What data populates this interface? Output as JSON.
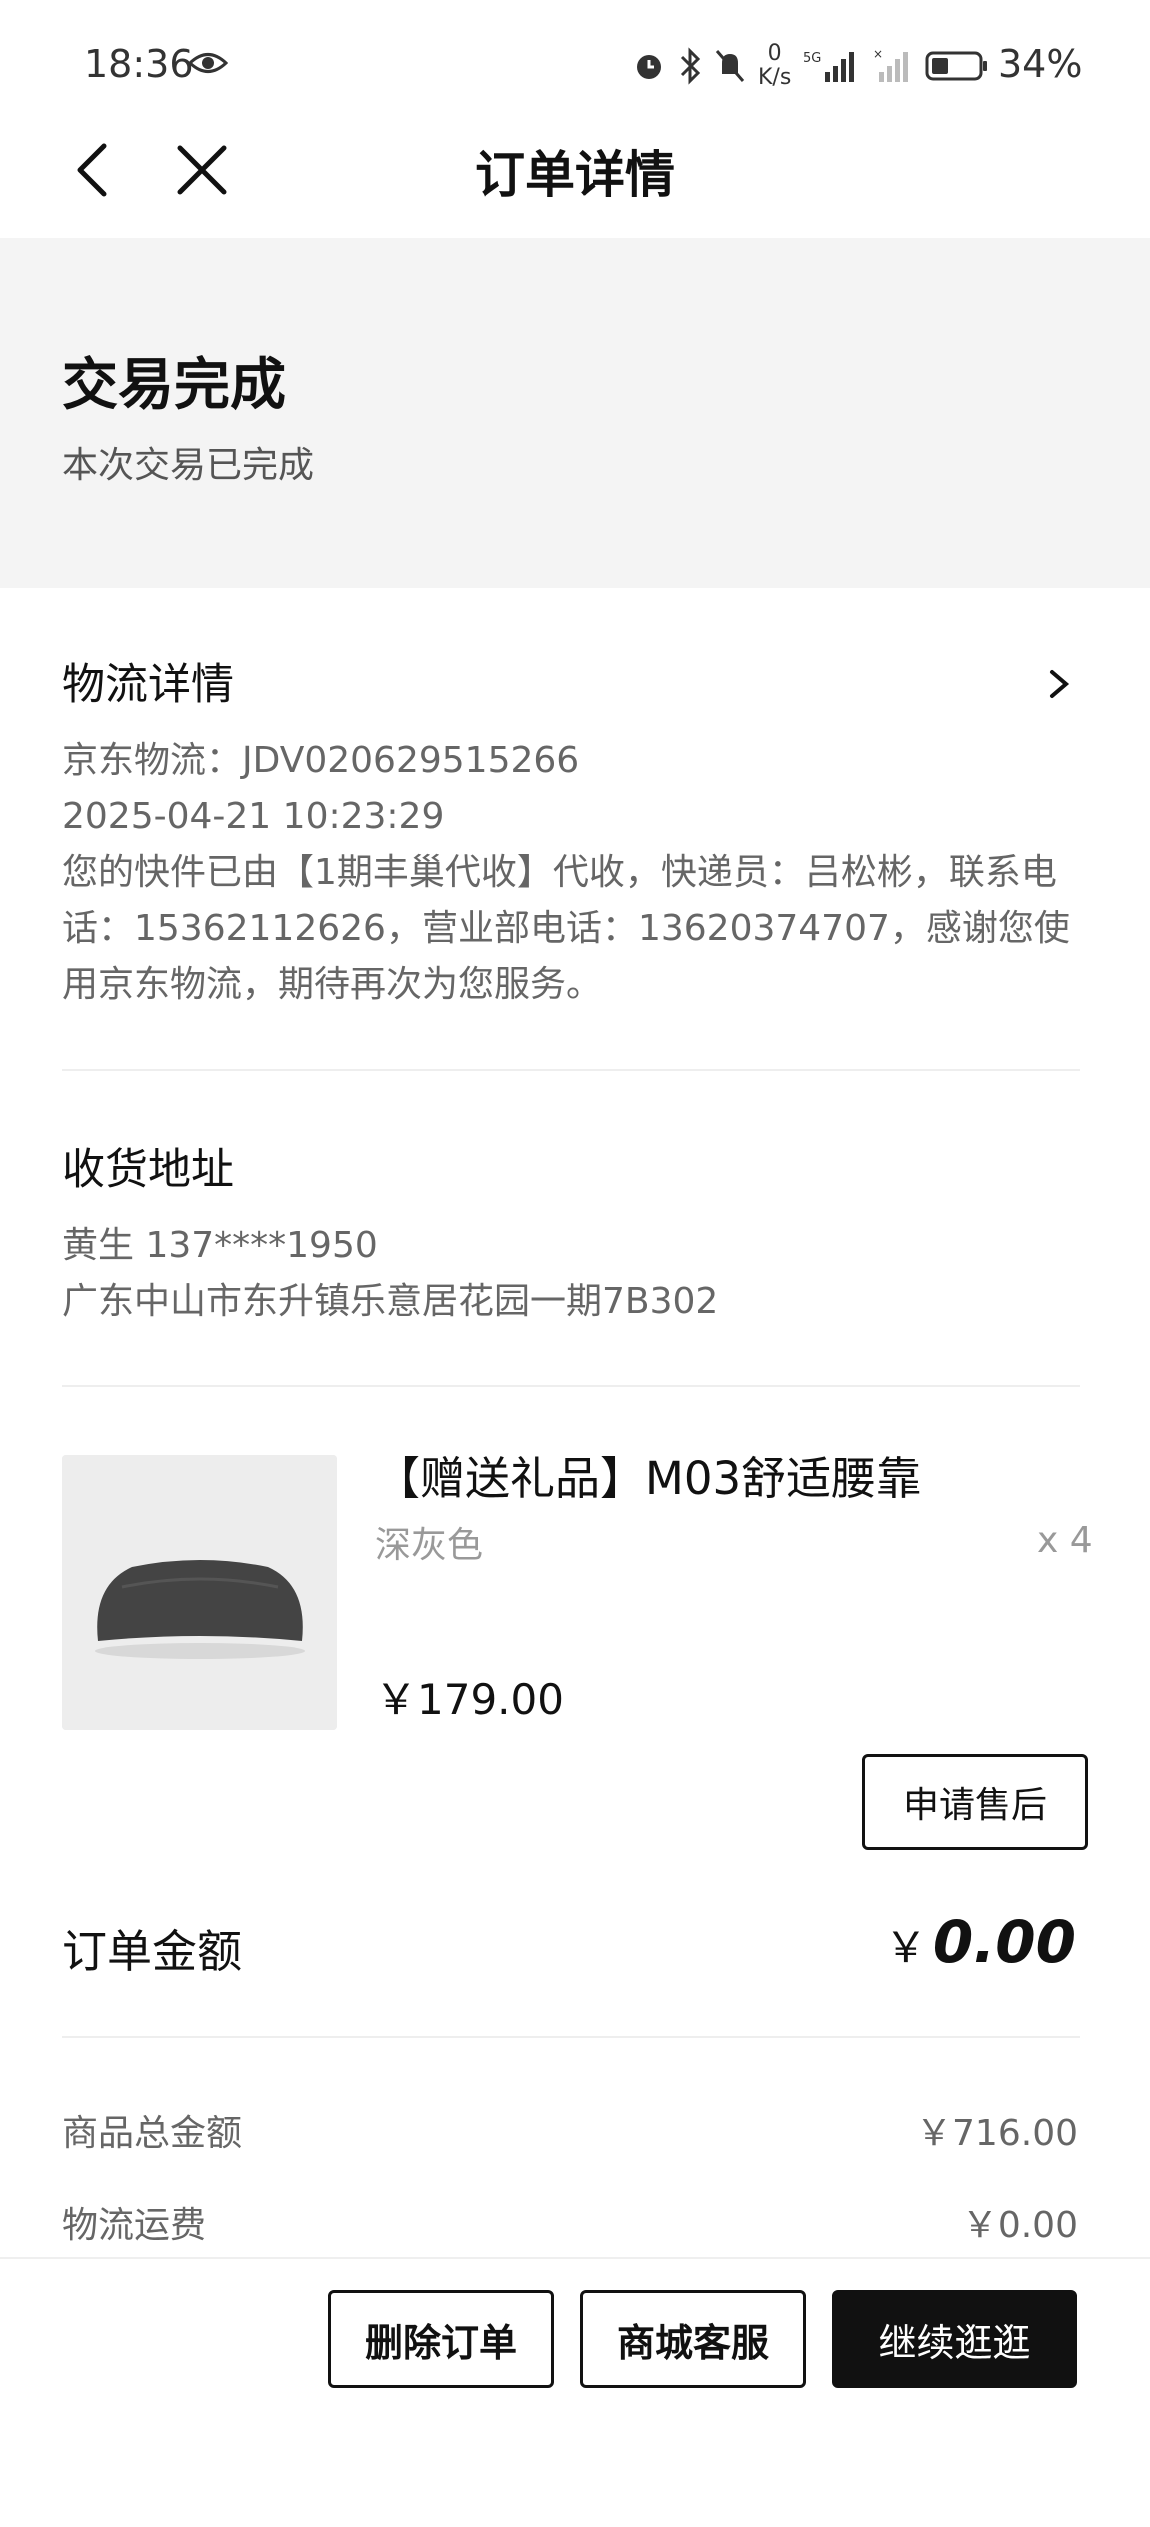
{
  "status_bar": {
    "time": "18:36",
    "net_speed_value": "0",
    "net_speed_unit": "K/s",
    "battery": "34%",
    "icons": [
      "eye-icon",
      "alarm-icon",
      "bluetooth-icon",
      "mute-icon",
      "signal-5g-icon",
      "signal-icon",
      "battery-icon"
    ]
  },
  "nav": {
    "title": "订单详情"
  },
  "order_status": {
    "title": "交易完成",
    "subtitle": "本次交易已完成"
  },
  "logistics": {
    "title": "物流详情",
    "carrier_line": "京东物流：JDV020629515266",
    "timestamp": "2025-04-21 10:23:29",
    "message": "您的快件已由【1期丰巢代收】代收，快递员：吕松彬，联系电话：15362112626，营业部电话：13620374707，感谢您使用京东物流，期待再次为您服务。"
  },
  "address": {
    "title": "收货地址",
    "contact": "黄生  137****1950",
    "detail": "广东中山市东升镇乐意居花园一期7B302"
  },
  "product": {
    "name": "【赠送礼品】M03舒适腰靠",
    "variant": "深灰色",
    "quantity": "x 4",
    "price": "￥179.00",
    "after_sale_label": "申请售后"
  },
  "order_amount": {
    "label": "订单金额",
    "currency": "￥",
    "value": "0.00"
  },
  "summary": [
    {
      "label": "商品总金额",
      "value": "￥716.00"
    },
    {
      "label": "物流运费",
      "value": "￥0.00"
    }
  ],
  "footer": {
    "delete_label": "删除订单",
    "service_label": "商城客服",
    "continue_label": "继续逛逛"
  },
  "colors": {
    "primary_dark": "#111111",
    "panel_gray": "#f4f4f4",
    "text_gray": "#666666"
  }
}
